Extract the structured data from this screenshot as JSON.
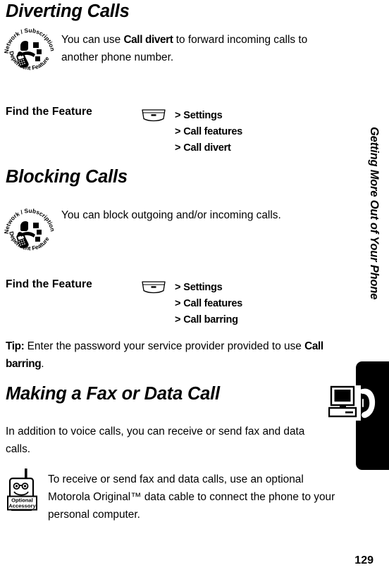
{
  "document": {
    "page_number": "129",
    "side_tab_title": "Getting More Out of Your Phone"
  },
  "sections": [
    {
      "heading": "Diverting Calls",
      "badge_icon": "network-subscription-dependent-feature-icon",
      "badge_text_top": "Network / Subscription",
      "badge_text_bottom": "Dependent  Feature",
      "paragraph_before": "You can use ",
      "paragraph_keyword": "Call divert",
      "paragraph_after": " to forward incoming calls to another phone number.",
      "find_feature_label": "Find the Feature",
      "menu_key_icon": "menu-key-icon",
      "steps": [
        {
          "arrow": ">",
          "label": "Settings"
        },
        {
          "arrow": ">",
          "label": "Call features"
        },
        {
          "arrow": ">",
          "label": "Call divert"
        }
      ]
    },
    {
      "heading": "Blocking Calls",
      "badge_icon": "network-subscription-dependent-feature-icon",
      "badge_text_top": "Network / Subscription",
      "badge_text_bottom": "Dependent  Feature",
      "paragraph_before": "You can block outgoing and/or incoming calls.",
      "paragraph_keyword": "",
      "paragraph_after": "",
      "find_feature_label": "Find the Feature",
      "menu_key_icon": "menu-key-icon",
      "steps": [
        {
          "arrow": ">",
          "label": "Settings"
        },
        {
          "arrow": ">",
          "label": "Call features"
        },
        {
          "arrow": ">",
          "label": "Call barring"
        }
      ]
    }
  ],
  "tip": {
    "label": "Tip:",
    "text_before": " Enter the password your service provider provided to use ",
    "keyword": "Call barring",
    "text_after": "."
  },
  "fax_section": {
    "heading": "Making a Fax or Data Call",
    "paragraph": "In addition to voice calls, you can receive or send fax and data calls.",
    "accessory_icon": "optional-accessory-icon",
    "accessory_label_line1": "Optional",
    "accessory_label_line2": "Accessory",
    "accessory_paragraph": "To receive or send fax and data calls, use an optional Motorola Original™ data cable to connect the phone to your personal computer."
  },
  "colors": {
    "ink": "#000000",
    "paper": "#ffffff",
    "tab": "#000000"
  }
}
